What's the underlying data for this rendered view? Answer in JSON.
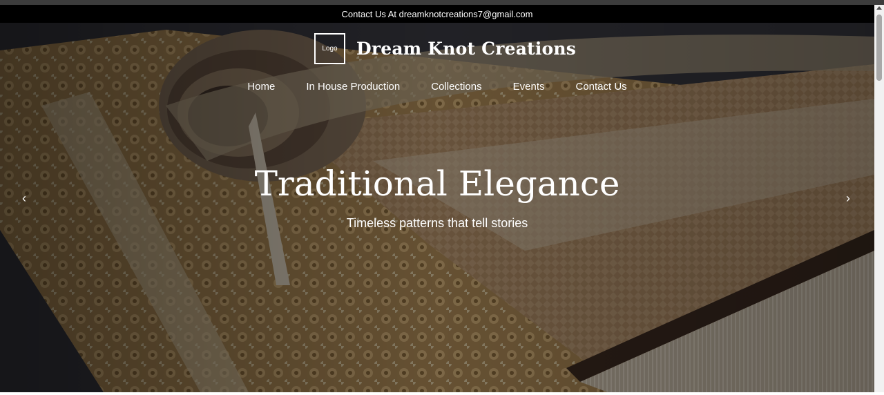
{
  "topbar": {
    "text": "Contact Us At dreamknotcreations7@gmail.com"
  },
  "header": {
    "logo_text": "Logo",
    "brand_name": "Dream Knot Creations"
  },
  "nav": {
    "items": [
      {
        "label": "Home"
      },
      {
        "label": "In House Production"
      },
      {
        "label": "Collections"
      },
      {
        "label": "Events"
      },
      {
        "label": "Contact Us"
      }
    ]
  },
  "hero": {
    "title": "Traditional Elegance",
    "subtitle": "Timeless patterns that tell stories",
    "prev_icon": "chevron-left-icon",
    "next_icon": "chevron-right-icon",
    "prev_symbol": "‹",
    "next_symbol": "›",
    "background_image": "rolled carpet with fringe"
  },
  "colors": {
    "topbar_bg": "#000000",
    "text": "#ffffff"
  }
}
